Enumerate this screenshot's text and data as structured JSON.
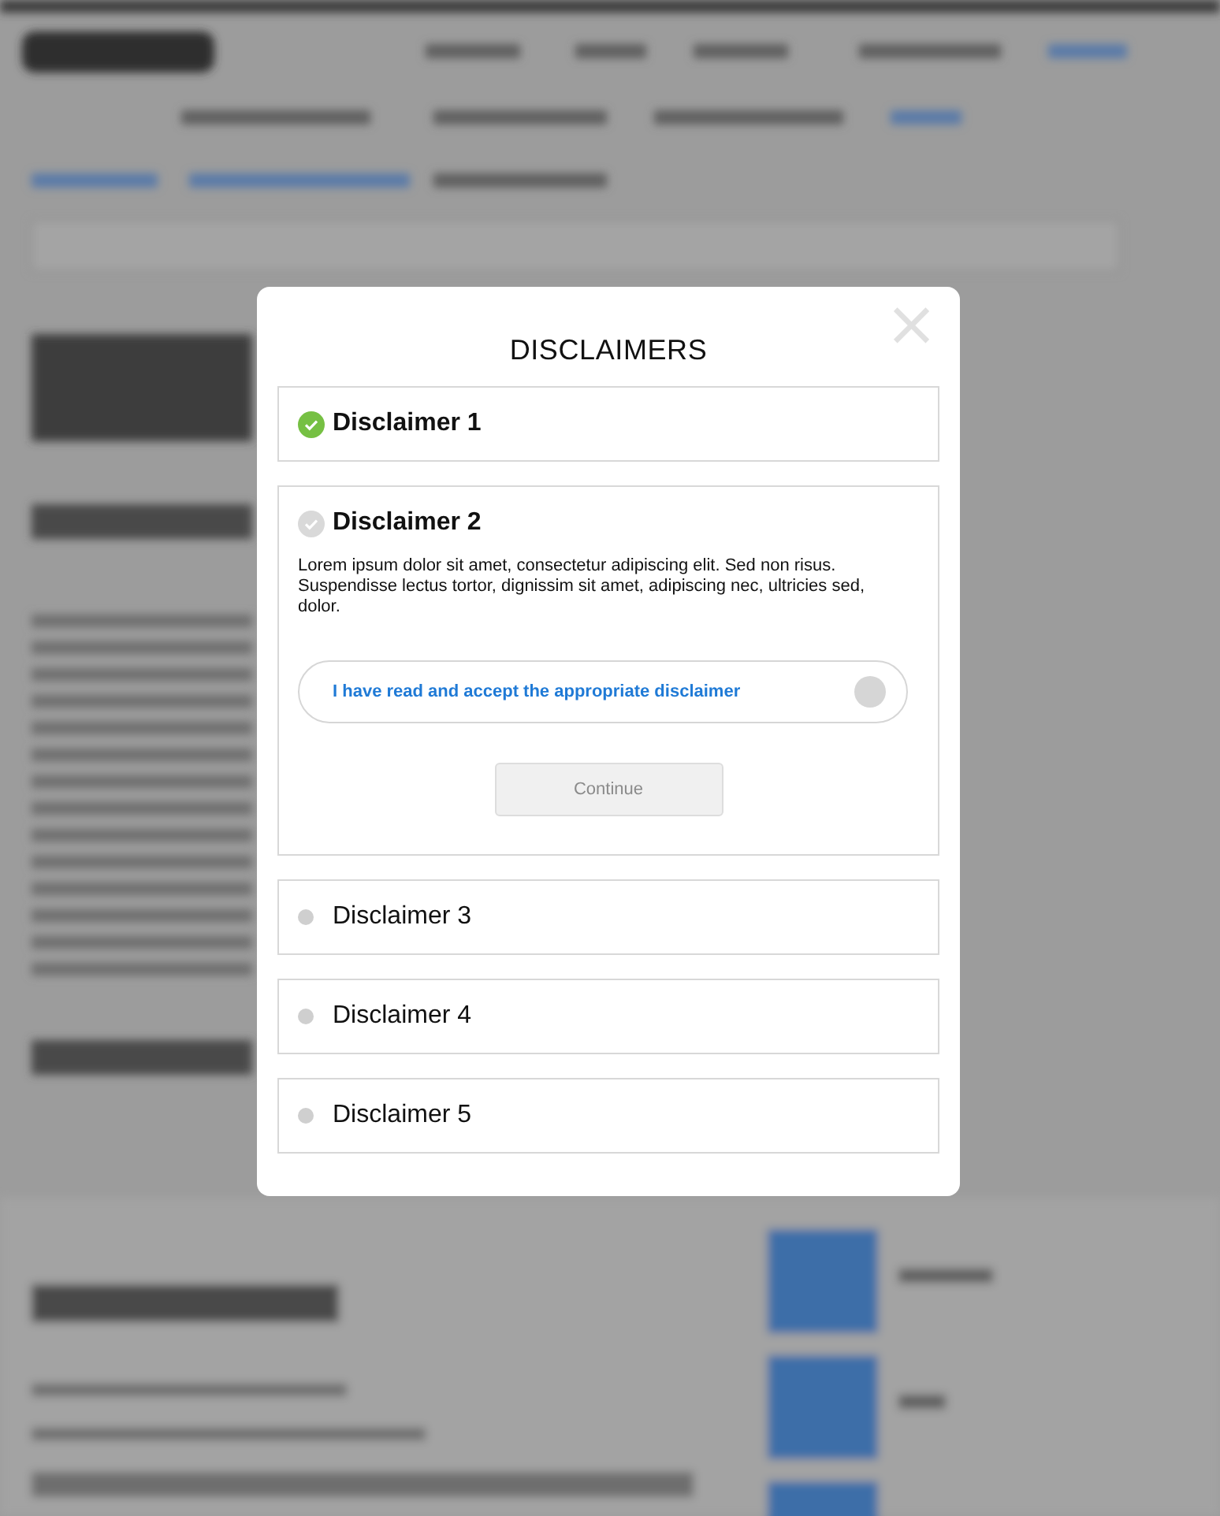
{
  "dialog": {
    "title": "DISCLAIMERS",
    "close_icon": "×",
    "items": [
      {
        "title": "Disclaimer 1",
        "kind": "done",
        "expanded": false
      },
      {
        "title": "Disclaimer 2",
        "kind": "current",
        "expanded": true,
        "body": "Lorem ipsum dolor sit amet, consectetur adipiscing elit. Sed non risus. Suspendisse lectus tortor, dignissim sit amet, adipiscing nec, ultricies sed, dolor.",
        "accept": {
          "label": "I have read and accept the appropriate disclaimer",
          "on": false
        },
        "button": {
          "label": "Continue",
          "disabled": true
        }
      },
      {
        "title": "Disclaimer 3",
        "kind": "pending",
        "expanded": false
      },
      {
        "title": "Disclaimer 4",
        "kind": "pending",
        "expanded": false
      },
      {
        "title": "Disclaimer 5",
        "kind": "pending",
        "expanded": false
      }
    ]
  }
}
